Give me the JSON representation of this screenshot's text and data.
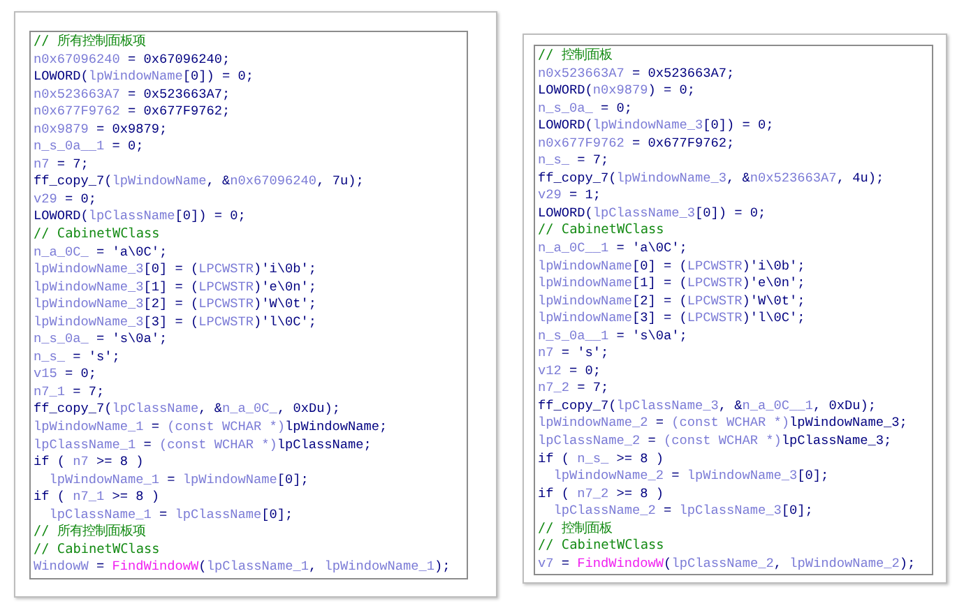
{
  "panels": [
    {
      "lines": [
        {
          "tokens": [
            {
              "kind": "comment",
              "text": "// 所有控制面板项"
            }
          ]
        },
        {
          "tokens": [
            {
              "kind": "var",
              "text": "n0x67096240"
            },
            {
              "kind": "code",
              "text": " = 0x67096240;"
            }
          ]
        },
        {
          "tokens": [
            {
              "kind": "code",
              "text": "LOWORD("
            },
            {
              "kind": "var",
              "text": "lpWindowName"
            },
            {
              "kind": "code",
              "text": "[0]) = 0;"
            }
          ]
        },
        {
          "tokens": [
            {
              "kind": "var",
              "text": "n0x523663A7"
            },
            {
              "kind": "code",
              "text": " = 0x523663A7;"
            }
          ]
        },
        {
          "tokens": [
            {
              "kind": "var",
              "text": "n0x677F9762"
            },
            {
              "kind": "code",
              "text": " = 0x677F9762;"
            }
          ]
        },
        {
          "tokens": [
            {
              "kind": "var",
              "text": "n0x9879"
            },
            {
              "kind": "code",
              "text": " = 0x9879;"
            }
          ]
        },
        {
          "tokens": [
            {
              "kind": "var",
              "text": "n_s_0a__1"
            },
            {
              "kind": "code",
              "text": " = 0;"
            }
          ]
        },
        {
          "tokens": [
            {
              "kind": "var",
              "text": "n7"
            },
            {
              "kind": "code",
              "text": " = 7;"
            }
          ]
        },
        {
          "tokens": [
            {
              "kind": "code",
              "text": "ff_copy_7("
            },
            {
              "kind": "var",
              "text": "lpWindowName"
            },
            {
              "kind": "code",
              "text": ", &"
            },
            {
              "kind": "var",
              "text": "n0x67096240"
            },
            {
              "kind": "code",
              "text": ", 7u);"
            }
          ]
        },
        {
          "tokens": [
            {
              "kind": "var",
              "text": "v29"
            },
            {
              "kind": "code",
              "text": " = 0;"
            }
          ]
        },
        {
          "tokens": [
            {
              "kind": "code",
              "text": "LOWORD("
            },
            {
              "kind": "var",
              "text": "lpClassName"
            },
            {
              "kind": "code",
              "text": "[0]) = 0;"
            }
          ]
        },
        {
          "tokens": [
            {
              "kind": "comment",
              "text": "// CabinetWClass"
            }
          ]
        },
        {
          "tokens": [
            {
              "kind": "var",
              "text": "n_a_0C_"
            },
            {
              "kind": "code",
              "text": " = 'a\\0C';"
            }
          ]
        },
        {
          "tokens": [
            {
              "kind": "var",
              "text": "lpWindowName_3"
            },
            {
              "kind": "code",
              "text": "[0] = ("
            },
            {
              "kind": "var",
              "text": "LPCWSTR"
            },
            {
              "kind": "code",
              "text": ")'i\\0b';"
            }
          ]
        },
        {
          "tokens": [
            {
              "kind": "var",
              "text": "lpWindowName_3"
            },
            {
              "kind": "code",
              "text": "[1] = ("
            },
            {
              "kind": "var",
              "text": "LPCWSTR"
            },
            {
              "kind": "code",
              "text": ")'e\\0n';"
            }
          ]
        },
        {
          "tokens": [
            {
              "kind": "var",
              "text": "lpWindowName_3"
            },
            {
              "kind": "code",
              "text": "[2] = ("
            },
            {
              "kind": "var",
              "text": "LPCWSTR"
            },
            {
              "kind": "code",
              "text": ")'W\\0t';"
            }
          ]
        },
        {
          "tokens": [
            {
              "kind": "var",
              "text": "lpWindowName_3"
            },
            {
              "kind": "code",
              "text": "[3] = ("
            },
            {
              "kind": "var",
              "text": "LPCWSTR"
            },
            {
              "kind": "code",
              "text": ")'l\\0C';"
            }
          ]
        },
        {
          "tokens": [
            {
              "kind": "var",
              "text": "n_s_0a_"
            },
            {
              "kind": "code",
              "text": " = 's\\0a';"
            }
          ]
        },
        {
          "tokens": [
            {
              "kind": "var",
              "text": "n_s_"
            },
            {
              "kind": "code",
              "text": " = 's';"
            }
          ]
        },
        {
          "tokens": [
            {
              "kind": "var",
              "text": "v15"
            },
            {
              "kind": "code",
              "text": " = 0;"
            }
          ]
        },
        {
          "tokens": [
            {
              "kind": "var",
              "text": "n7_1"
            },
            {
              "kind": "code",
              "text": " = 7;"
            }
          ]
        },
        {
          "tokens": [
            {
              "kind": "code",
              "text": "ff_copy_7("
            },
            {
              "kind": "var",
              "text": "lpClassName"
            },
            {
              "kind": "code",
              "text": ", &"
            },
            {
              "kind": "var",
              "text": "n_a_0C_"
            },
            {
              "kind": "code",
              "text": ", 0xDu);"
            }
          ]
        },
        {
          "tokens": [
            {
              "kind": "var",
              "text": "lpWindowName_1"
            },
            {
              "kind": "code",
              "text": " = "
            },
            {
              "kind": "var",
              "text": "(const WCHAR *)"
            },
            {
              "kind": "code",
              "text": "lpWindowName;"
            }
          ]
        },
        {
          "tokens": [
            {
              "kind": "var",
              "text": "lpClassName_1"
            },
            {
              "kind": "code",
              "text": " = "
            },
            {
              "kind": "var",
              "text": "(const WCHAR *)"
            },
            {
              "kind": "code",
              "text": "lpClassName;"
            }
          ]
        },
        {
          "tokens": [
            {
              "kind": "code",
              "text": "if ( "
            },
            {
              "kind": "var",
              "text": "n7"
            },
            {
              "kind": "code",
              "text": " >= 8 )"
            }
          ],
          "children": [
            {
              "tokens": [
                {
                  "kind": "var",
                  "text": "lpWindowName_1"
                },
                {
                  "kind": "code",
                  "text": " = "
                },
                {
                  "kind": "var",
                  "text": "lpWindowName"
                },
                {
                  "kind": "code",
                  "text": "[0];"
                }
              ]
            }
          ]
        },
        {
          "tokens": [
            {
              "kind": "code",
              "text": "if ( "
            },
            {
              "kind": "var",
              "text": "n7_1"
            },
            {
              "kind": "code",
              "text": " >= 8 )"
            }
          ],
          "children": [
            {
              "tokens": [
                {
                  "kind": "var",
                  "text": "lpClassName_1"
                },
                {
                  "kind": "code",
                  "text": " = "
                },
                {
                  "kind": "var",
                  "text": "lpClassName"
                },
                {
                  "kind": "code",
                  "text": "[0];"
                }
              ]
            }
          ]
        },
        {
          "tokens": [
            {
              "kind": "comment",
              "text": "// 所有控制面板项"
            }
          ]
        },
        {
          "tokens": [
            {
              "kind": "comment",
              "text": "// CabinetWClass"
            }
          ]
        },
        {
          "tokens": [
            {
              "kind": "var",
              "text": "WindowW"
            },
            {
              "kind": "code",
              "text": " = "
            },
            {
              "kind": "call",
              "text": "FindWindowW"
            },
            {
              "kind": "code",
              "text": "("
            },
            {
              "kind": "var",
              "text": "lpClassName_1"
            },
            {
              "kind": "code",
              "text": ", "
            },
            {
              "kind": "var",
              "text": "lpWindowName_1"
            },
            {
              "kind": "code",
              "text": ");"
            }
          ]
        }
      ]
    },
    {
      "lines": [
        {
          "tokens": [
            {
              "kind": "comment",
              "text": "// 控制面板"
            }
          ]
        },
        {
          "tokens": [
            {
              "kind": "var",
              "text": "n0x523663A7"
            },
            {
              "kind": "code",
              "text": " = 0x523663A7;"
            }
          ]
        },
        {
          "tokens": [
            {
              "kind": "code",
              "text": "LOWORD("
            },
            {
              "kind": "var",
              "text": "n0x9879"
            },
            {
              "kind": "code",
              "text": ") = 0;"
            }
          ]
        },
        {
          "tokens": [
            {
              "kind": "var",
              "text": "n_s_0a_"
            },
            {
              "kind": "code",
              "text": " = 0;"
            }
          ]
        },
        {
          "tokens": [
            {
              "kind": "code",
              "text": "LOWORD("
            },
            {
              "kind": "var",
              "text": "lpWindowName_3"
            },
            {
              "kind": "code",
              "text": "[0]) = 0;"
            }
          ]
        },
        {
          "tokens": [
            {
              "kind": "var",
              "text": "n0x677F9762"
            },
            {
              "kind": "code",
              "text": " = 0x677F9762;"
            }
          ]
        },
        {
          "tokens": [
            {
              "kind": "var",
              "text": "n_s_"
            },
            {
              "kind": "code",
              "text": " = 7;"
            }
          ]
        },
        {
          "tokens": [
            {
              "kind": "code",
              "text": "ff_copy_7("
            },
            {
              "kind": "var",
              "text": "lpWindowName_3"
            },
            {
              "kind": "code",
              "text": ", &"
            },
            {
              "kind": "var",
              "text": "n0x523663A7"
            },
            {
              "kind": "code",
              "text": ", 4u);"
            }
          ]
        },
        {
          "tokens": [
            {
              "kind": "var",
              "text": "v29"
            },
            {
              "kind": "code",
              "text": " = 1;"
            }
          ]
        },
        {
          "tokens": [
            {
              "kind": "code",
              "text": "LOWORD("
            },
            {
              "kind": "var",
              "text": "lpClassName_3"
            },
            {
              "kind": "code",
              "text": "[0]) = 0;"
            }
          ]
        },
        {
          "tokens": [
            {
              "kind": "comment",
              "text": "// CabinetWClass"
            }
          ]
        },
        {
          "tokens": [
            {
              "kind": "var",
              "text": "n_a_0C__1"
            },
            {
              "kind": "code",
              "text": " = 'a\\0C';"
            }
          ]
        },
        {
          "tokens": [
            {
              "kind": "var",
              "text": "lpWindowName"
            },
            {
              "kind": "code",
              "text": "[0] = ("
            },
            {
              "kind": "var",
              "text": "LPCWSTR"
            },
            {
              "kind": "code",
              "text": ")'i\\0b';"
            }
          ]
        },
        {
          "tokens": [
            {
              "kind": "var",
              "text": "lpWindowName"
            },
            {
              "kind": "code",
              "text": "[1] = ("
            },
            {
              "kind": "var",
              "text": "LPCWSTR"
            },
            {
              "kind": "code",
              "text": ")'e\\0n';"
            }
          ]
        },
        {
          "tokens": [
            {
              "kind": "var",
              "text": "lpWindowName"
            },
            {
              "kind": "code",
              "text": "[2] = ("
            },
            {
              "kind": "var",
              "text": "LPCWSTR"
            },
            {
              "kind": "code",
              "text": ")'W\\0t';"
            }
          ]
        },
        {
          "tokens": [
            {
              "kind": "var",
              "text": "lpWindowName"
            },
            {
              "kind": "code",
              "text": "[3] = ("
            },
            {
              "kind": "var",
              "text": "LPCWSTR"
            },
            {
              "kind": "code",
              "text": ")'l\\0C';"
            }
          ]
        },
        {
          "tokens": [
            {
              "kind": "var",
              "text": "n_s_0a__1"
            },
            {
              "kind": "code",
              "text": " = 's\\0a';"
            }
          ]
        },
        {
          "tokens": [
            {
              "kind": "var",
              "text": "n7"
            },
            {
              "kind": "code",
              "text": " = 's';"
            }
          ]
        },
        {
          "tokens": [
            {
              "kind": "var",
              "text": "v12"
            },
            {
              "kind": "code",
              "text": " = 0;"
            }
          ]
        },
        {
          "tokens": [
            {
              "kind": "var",
              "text": "n7_2"
            },
            {
              "kind": "code",
              "text": " = 7;"
            }
          ]
        },
        {
          "tokens": [
            {
              "kind": "code",
              "text": "ff_copy_7("
            },
            {
              "kind": "var",
              "text": "lpClassName_3"
            },
            {
              "kind": "code",
              "text": ", &"
            },
            {
              "kind": "var",
              "text": "n_a_0C__1"
            },
            {
              "kind": "code",
              "text": ", 0xDu);"
            }
          ]
        },
        {
          "tokens": [
            {
              "kind": "var",
              "text": "lpWindowName_2"
            },
            {
              "kind": "code",
              "text": " = "
            },
            {
              "kind": "var",
              "text": "(const WCHAR *)"
            },
            {
              "kind": "code",
              "text": "lpWindowName_3;"
            }
          ]
        },
        {
          "tokens": [
            {
              "kind": "var",
              "text": "lpClassName_2"
            },
            {
              "kind": "code",
              "text": " = "
            },
            {
              "kind": "var",
              "text": "(const WCHAR *)"
            },
            {
              "kind": "code",
              "text": "lpClassName_3;"
            }
          ]
        },
        {
          "tokens": [
            {
              "kind": "code",
              "text": "if ( "
            },
            {
              "kind": "var",
              "text": "n_s_"
            },
            {
              "kind": "code",
              "text": " >= 8 )"
            }
          ],
          "children": [
            {
              "tokens": [
                {
                  "kind": "var",
                  "text": "lpWindowName_2"
                },
                {
                  "kind": "code",
                  "text": " = "
                },
                {
                  "kind": "var",
                  "text": "lpWindowName_3"
                },
                {
                  "kind": "code",
                  "text": "[0];"
                }
              ]
            }
          ]
        },
        {
          "tokens": [
            {
              "kind": "code",
              "text": "if ( "
            },
            {
              "kind": "var",
              "text": "n7_2"
            },
            {
              "kind": "code",
              "text": " >= 8 )"
            }
          ],
          "children": [
            {
              "tokens": [
                {
                  "kind": "var",
                  "text": "lpClassName_2"
                },
                {
                  "kind": "code",
                  "text": " = "
                },
                {
                  "kind": "var",
                  "text": "lpClassName_3"
                },
                {
                  "kind": "code",
                  "text": "[0];"
                }
              ]
            }
          ]
        },
        {
          "tokens": [
            {
              "kind": "comment",
              "text": "// 控制面板"
            }
          ]
        },
        {
          "tokens": [
            {
              "kind": "comment",
              "text": "// CabinetWClass"
            }
          ]
        },
        {
          "tokens": [
            {
              "kind": "var",
              "text": "v7"
            },
            {
              "kind": "code",
              "text": " = "
            },
            {
              "kind": "call",
              "text": "FindWindowW"
            },
            {
              "kind": "code",
              "text": "("
            },
            {
              "kind": "var",
              "text": "lpClassName_2"
            },
            {
              "kind": "code",
              "text": ", "
            },
            {
              "kind": "var",
              "text": "lpWindowName_2"
            },
            {
              "kind": "code",
              "text": ");"
            }
          ]
        }
      ]
    }
  ]
}
